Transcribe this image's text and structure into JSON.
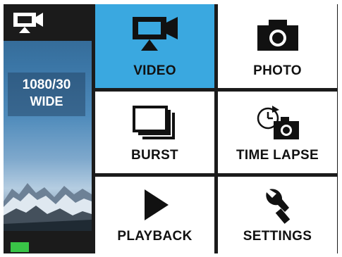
{
  "sidebar": {
    "current_mode_icon": "video-camera-icon",
    "resolution": "1080/30",
    "fov": "WIDE",
    "battery_color": "#39c447"
  },
  "menu": {
    "items": [
      {
        "label": "VIDEO",
        "icon": "video-camera-icon",
        "selected": true
      },
      {
        "label": "PHOTO",
        "icon": "camera-icon",
        "selected": false
      },
      {
        "label": "BURST",
        "icon": "burst-stack-icon",
        "selected": false
      },
      {
        "label": "TIME LAPSE",
        "icon": "time-lapse-icon",
        "selected": false
      },
      {
        "label": "PLAYBACK",
        "icon": "play-icon",
        "selected": false
      },
      {
        "label": "SETTINGS",
        "icon": "wrench-icon",
        "selected": false
      }
    ]
  },
  "colors": {
    "selected": "#3aa8e0",
    "tile": "#ffffff",
    "background": "#1b1b1b"
  }
}
